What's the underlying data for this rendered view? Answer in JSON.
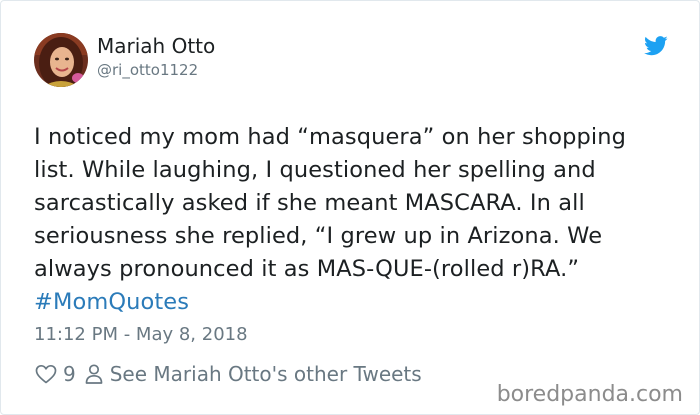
{
  "tweet": {
    "author": {
      "display_name": "Mariah Otto",
      "handle": "@ri_otto1122",
      "avatar_icon": "user-avatar-photo"
    },
    "brand_icon": "twitter-bird-icon",
    "brand_color": "#1da1f2",
    "text_lines": [
      "I noticed my mom had “masquera” on her shopping",
      "list. While laughing, I questioned her spelling and",
      "sarcastically asked if she meant MASCARA. In all",
      "seriousness she replied, “I grew up in Arizona. We",
      "always pronounced it as MAS-QUE-(rolled r)RA.”"
    ],
    "hashtag": "#MomQuotes",
    "hashtag_color": "#2b7bb9",
    "timestamp": "11:12 PM - May 8, 2018",
    "likes": {
      "icon": "heart-icon",
      "count": "9"
    },
    "other_tweets": {
      "icon": "person-icon",
      "label": "See Mariah Otto's other Tweets"
    }
  },
  "watermark": "boredpanda.com"
}
